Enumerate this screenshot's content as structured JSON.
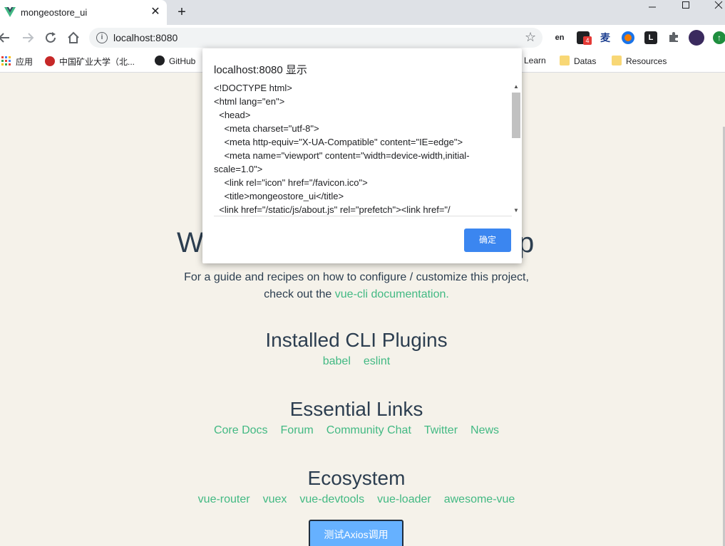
{
  "browser": {
    "tab_title": "mongeostore_ui",
    "close_glyph": "✕",
    "new_tab_glyph": "+",
    "url": "localhost:8080",
    "bookmarks": [
      {
        "label": "应用",
        "icon": "apps-grid-icon"
      },
      {
        "label": "中国矿业大学（北...",
        "icon": "university-icon"
      },
      {
        "label": "GitHub",
        "icon": "github-icon"
      },
      {
        "label": "Learn",
        "icon": "folder-icon"
      },
      {
        "label": "Datas",
        "icon": "folder-icon"
      },
      {
        "label": "Resources",
        "icon": "folder-icon"
      }
    ],
    "extension_badge": "4"
  },
  "dialog": {
    "title": "localhost:8080 显示",
    "body": "<!DOCTYPE html>\n<html lang=\"en\">\n  <head>\n    <meta charset=\"utf-8\">\n    <meta http-equiv=\"X-UA-Compatible\" content=\"IE=edge\">\n    <meta name=\"viewport\" content=\"width=device-width,initial-scale=1.0\">\n    <link rel=\"icon\" href=\"/favicon.ico\">\n    <title>mongeostore_ui</title>\n  <link href=\"/static/js/about.js\" rel=\"prefetch\"><link href=\"/",
    "ok_label": "确定"
  },
  "page": {
    "welcome_left": "W",
    "welcome_right": "p",
    "intro_line1": "For a guide and recipes on how to configure / customize this project,",
    "intro_line2_prefix": "check out the ",
    "intro_link": "vue-cli documentation",
    "intro_suffix": ".",
    "plugins_heading": "Installed CLI Plugins",
    "plugins": [
      "babel",
      "eslint"
    ],
    "links_heading": "Essential Links",
    "links": [
      "Core Docs",
      "Forum",
      "Community Chat",
      "Twitter",
      "News"
    ],
    "eco_heading": "Ecosystem",
    "eco": [
      "vue-router",
      "vuex",
      "vue-devtools",
      "vue-loader",
      "awesome-vue"
    ],
    "axios_button": "测试Axios调用"
  },
  "colors": {
    "accent_green": "#42b983",
    "dialog_button": "#3b86f0",
    "axios_button": "#66b1ff"
  }
}
